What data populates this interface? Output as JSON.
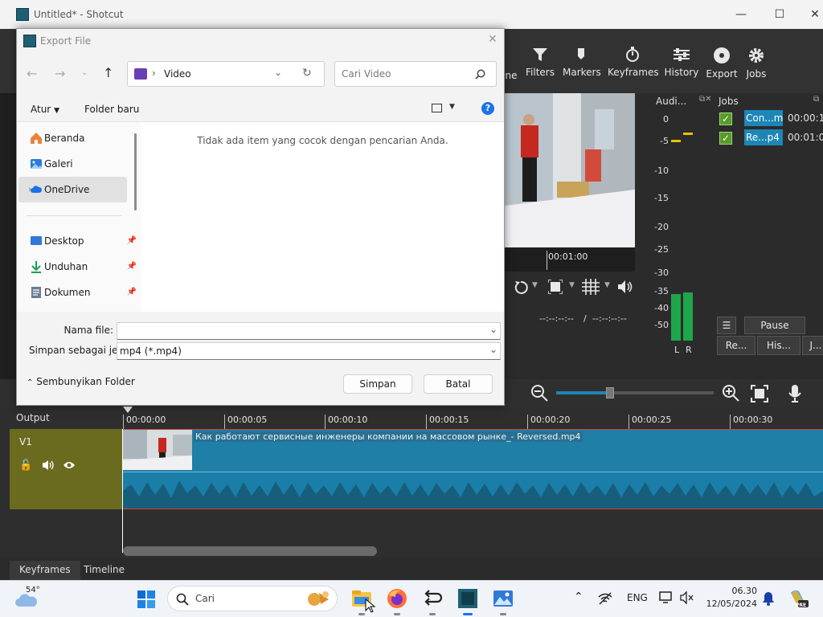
{
  "window": {
    "title": "Untitled* - Shotcut",
    "controls": [
      "minimize-icon",
      "maximize-icon",
      "close-icon"
    ]
  },
  "toolbar": {
    "partial_label": "ne",
    "items": [
      {
        "label": "Filters",
        "icon": "funnel-icon"
      },
      {
        "label": "Markers",
        "icon": "marker-icon"
      },
      {
        "label": "Keyframes",
        "icon": "stopwatch-icon"
      },
      {
        "label": "History",
        "icon": "sliders-icon"
      },
      {
        "label": "Export",
        "icon": "disc-icon"
      },
      {
        "label": "Jobs",
        "icon": "gear-icon"
      }
    ]
  },
  "player": {
    "timecode_marker": "00:01:00",
    "in_point": "--:--:--:--",
    "separator": "/",
    "out_point": "--:--:--:--"
  },
  "audio_meter": {
    "title": "Audi...",
    "scale": [
      "0",
      "-5",
      "-10",
      "-15",
      "-20",
      "-25",
      "-30",
      "-35",
      "-40",
      "-50"
    ],
    "channels": [
      "L",
      "R"
    ],
    "level_left_db": -41,
    "level_right_db": -38
  },
  "jobs": {
    "title": "Jobs",
    "items": [
      {
        "name": "Con...mp",
        "time": "00:00:1"
      },
      {
        "name": "Re...p4",
        "time": "00:01:0"
      }
    ],
    "pause_queue": "Pause Queue",
    "bottom_buttons": [
      "Re...",
      "His...",
      "J..."
    ]
  },
  "timeline": {
    "output_label": "Output",
    "track_name": "V1",
    "ruler": [
      "00:00:00",
      "00:00:05",
      "00:00:10",
      "00:00:15",
      "00:00:20",
      "00:00:25",
      "00:00:30"
    ],
    "clip_name": "Как работают сервисные инженеры компании на массовом рынке_- Reversed.mp4"
  },
  "bottom_tabs": [
    "Keyframes",
    "Timeline"
  ],
  "dialog": {
    "title": "Export File",
    "address_folder": "Video",
    "search_placeholder": "Cari Video",
    "organize": "Atur",
    "new_folder": "Folder baru",
    "empty_message": "Tidak ada item yang cocok dengan pencarian Anda.",
    "sidebar": [
      {
        "label": "Beranda",
        "icon": "home-icon"
      },
      {
        "label": "Galeri",
        "icon": "gallery-icon"
      },
      {
        "label": "OneDrive",
        "icon": "cloud-icon",
        "selected": true
      },
      {
        "label": "Desktop",
        "icon": "desktop-icon",
        "pinned": true
      },
      {
        "label": "Unduhan",
        "icon": "download-icon",
        "pinned": true
      },
      {
        "label": "Dokumen",
        "icon": "document-icon",
        "pinned": true
      }
    ],
    "filename_label": "Nama file:",
    "filename_value": "",
    "savetype_label": "Simpan sebagai je...",
    "savetype_value": "mp4 (*.mp4)",
    "hide_folders": "Sembunyikan Folder",
    "save": "Simpan",
    "cancel": "Batal"
  },
  "taskbar": {
    "weather": "54°",
    "search_placeholder": "Cari",
    "language": "ENG",
    "time": "06.30",
    "date": "12/05/2024",
    "copilot_badge": "PRE"
  },
  "colors": {
    "accent": "#1d86b6",
    "track_head": "#6b6b1f",
    "meter_green": "#1fa64a",
    "meter_yellow": "#e6c200",
    "clip_border": "#cc4444"
  }
}
